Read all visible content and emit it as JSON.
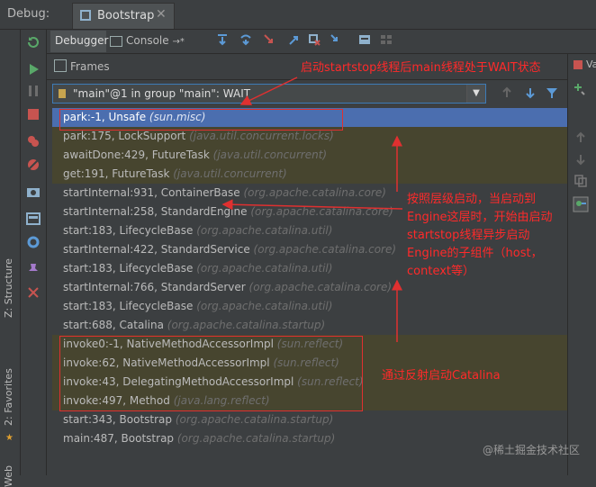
{
  "debug_bar": {
    "title": "Debug:",
    "tab_label": "Bootstrap"
  },
  "toolbar": {
    "debugger_tab": "Debugger",
    "console_tab": "Console",
    "console_suffix": "→*"
  },
  "frames": {
    "header": "Frames",
    "corner_label": "Va"
  },
  "thread": {
    "label": "\"main\"@1 in group \"main\": WAIT"
  },
  "left_strip": {
    "structure": "Z: Structure",
    "favorites": "2: Favorites",
    "web": "Web"
  },
  "stack_frames": [
    {
      "method": "park:-1, Unsafe",
      "pkg": "(sun.misc)",
      "style": "sel"
    },
    {
      "method": "park:175, LockSupport",
      "pkg": "(java.util.concurrent.locks)",
      "style": "lib"
    },
    {
      "method": "awaitDone:429, FutureTask",
      "pkg": "(java.util.concurrent)",
      "style": "lib"
    },
    {
      "method": "get:191, FutureTask",
      "pkg": "(java.util.concurrent)",
      "style": "lib"
    },
    {
      "method": "startInternal:931, ContainerBase",
      "pkg": "(org.apache.catalina.core)",
      "style": ""
    },
    {
      "method": "startInternal:258, StandardEngine",
      "pkg": "(org.apache.catalina.core)",
      "style": ""
    },
    {
      "method": "start:183, LifecycleBase",
      "pkg": "(org.apache.catalina.util)",
      "style": ""
    },
    {
      "method": "startInternal:422, StandardService",
      "pkg": "(org.apache.catalina.core)",
      "style": ""
    },
    {
      "method": "start:183, LifecycleBase",
      "pkg": "(org.apache.catalina.util)",
      "style": ""
    },
    {
      "method": "startInternal:766, StandardServer",
      "pkg": "(org.apache.catalina.core)",
      "style": ""
    },
    {
      "method": "start:183, LifecycleBase",
      "pkg": "(org.apache.catalina.util)",
      "style": ""
    },
    {
      "method": "start:688, Catalina",
      "pkg": "(org.apache.catalina.startup)",
      "style": ""
    },
    {
      "method": "invoke0:-1, NativeMethodAccessorImpl",
      "pkg": "(sun.reflect)",
      "style": "lib"
    },
    {
      "method": "invoke:62, NativeMethodAccessorImpl",
      "pkg": "(sun.reflect)",
      "style": "lib"
    },
    {
      "method": "invoke:43, DelegatingMethodAccessorImpl",
      "pkg": "(sun.reflect)",
      "style": "lib"
    },
    {
      "method": "invoke:497, Method",
      "pkg": "(java.lang.reflect)",
      "style": "lib"
    },
    {
      "method": "start:343, Bootstrap",
      "pkg": "(org.apache.catalina.startup)",
      "style": ""
    },
    {
      "method": "main:487, Bootstrap",
      "pkg": "(org.apache.catalina.startup)",
      "style": ""
    }
  ],
  "annotations": {
    "top": "启动startstop线程后main线程处于WAIT状态",
    "middle": "按照层级启动，当启动到Engine这层时，开始由启动startstop线程异步启动Engine的子组件（host，context等）",
    "bottom": "通过反射启动Catalina"
  },
  "watermark": "@稀土掘金技术社区",
  "colors": {
    "accent": "#4b6eaf",
    "annotation": "#ff2a2a",
    "library_row": "#47452f"
  }
}
